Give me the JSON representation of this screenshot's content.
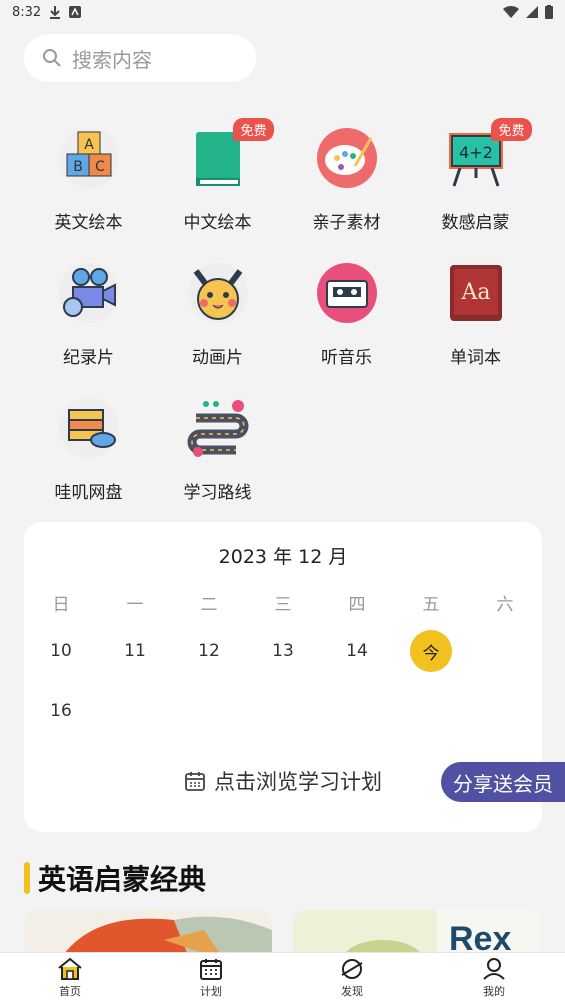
{
  "status": {
    "time": "8:32"
  },
  "search": {
    "placeholder": "搜索内容"
  },
  "grid": {
    "items": [
      {
        "label": "英文绘本",
        "badge": ""
      },
      {
        "label": "中文绘本",
        "badge": "免费"
      },
      {
        "label": "亲子素材",
        "badge": ""
      },
      {
        "label": "数感启蒙",
        "badge": "免费"
      },
      {
        "label": "纪录片",
        "badge": ""
      },
      {
        "label": "动画片",
        "badge": ""
      },
      {
        "label": "听音乐",
        "badge": ""
      },
      {
        "label": "单词本",
        "badge": ""
      },
      {
        "label": "哇叽网盘",
        "badge": ""
      },
      {
        "label": "学习路线",
        "badge": ""
      }
    ]
  },
  "calendar": {
    "title": "2023 年 12 月",
    "weekdays": [
      "日",
      "一",
      "二",
      "三",
      "四",
      "五",
      "六"
    ],
    "week1": [
      "10",
      "11",
      "12",
      "13",
      "14",
      "今"
    ],
    "week2": [
      "16"
    ],
    "plan_label": "点击浏览学习计划"
  },
  "share_label": "分享送会员",
  "section": {
    "title": "英语启蒙经典"
  },
  "books": [
    "Rex"
  ],
  "tabs": [
    "首页",
    "计划",
    "发现",
    "我的"
  ],
  "colors": {
    "accent": "#f0c11f",
    "share": "#5051a3",
    "badge": "#e9534c"
  }
}
